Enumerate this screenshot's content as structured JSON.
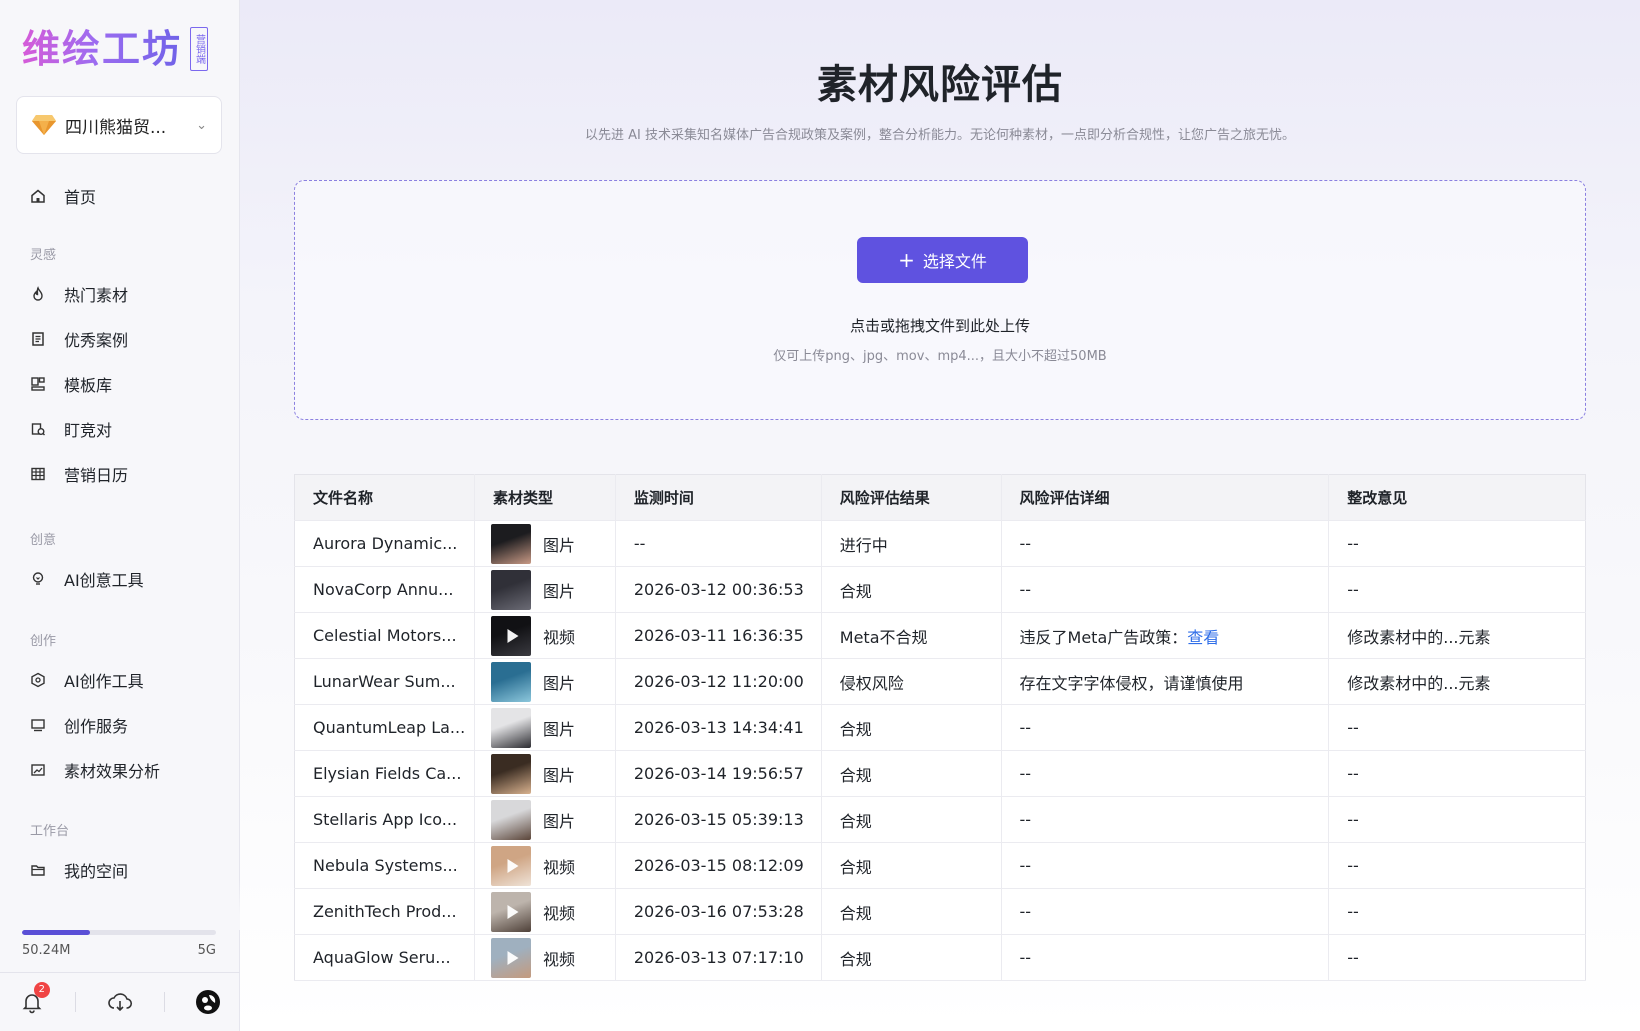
{
  "brand": {
    "logo_text": "维绘工坊",
    "logo_badge": "营销端"
  },
  "company": {
    "name": "四川熊猫贸..."
  },
  "nav": {
    "home": "首页",
    "group_inspire": "灵感",
    "hot": "热门素材",
    "cases": "优秀案例",
    "templates": "模板库",
    "competitor": "盯竞对",
    "calendar": "营销日历",
    "group_creative": "创意",
    "ai_idea": "AI创意工具",
    "group_create": "创作",
    "ai_create": "AI创作工具",
    "service": "创作服务",
    "analysis": "素材效果分析",
    "group_workspace": "工作台",
    "my_space": "我的空间"
  },
  "storage": {
    "used": "50.24M",
    "total": "5G",
    "fraction": 0.35
  },
  "notifications": {
    "count": "2"
  },
  "page": {
    "title": "素材风险评估",
    "subtitle": "以先进 AI 技术采集知名媒体广告合规政策及案例，整合分析能力。无论何种素材，一点即分析合规性，让您广告之旅无忧。"
  },
  "upload": {
    "button": "选择文件",
    "hint": "点击或拖拽文件到此处上传",
    "limit": "仅可上传png、jpg、mov、mp4...，且大小不超过50MB"
  },
  "table": {
    "headers": [
      "文件名称",
      "素材类型",
      "监测时间",
      "风险评估结果",
      "风险评估详细",
      "整改意见"
    ],
    "rows": [
      {
        "name": "Aurora Dynamic...",
        "type": "图片",
        "video": false,
        "time": "--",
        "result": "进行中",
        "status": "pending",
        "detail": "--",
        "detail_link": "",
        "advice": "--",
        "thumb": [
          "#1c1c1f",
          "#c99a86"
        ]
      },
      {
        "name": "NovaCorp Annu...",
        "type": "图片",
        "video": false,
        "time": "2026-03-12 00:36:53",
        "result": "合规",
        "status": "ok",
        "detail": "--",
        "detail_link": "",
        "advice": "--",
        "thumb": [
          "#303038",
          "#6b6b75"
        ]
      },
      {
        "name": "Celestial Motors...",
        "type": "视频",
        "video": true,
        "time": "2026-03-11 16:36:35",
        "result": "Meta不合规",
        "status": "bad",
        "detail": "违反了Meta广告政策：",
        "detail_link": "查看",
        "advice": "修改素材中的...元素",
        "thumb": [
          "#111114",
          "#3a3a40"
        ]
      },
      {
        "name": "LunarWear Sum...",
        "type": "图片",
        "video": false,
        "time": "2026-03-12 11:20:00",
        "result": "侵权风险",
        "status": "bad",
        "detail": "存在文字字体侵权，请谨慎使用",
        "detail_link": "",
        "advice": "修改素材中的...元素",
        "thumb": [
          "#2a6e92",
          "#8cc7dc"
        ]
      },
      {
        "name": "QuantumLeap La...",
        "type": "图片",
        "video": false,
        "time": "2026-03-13 14:34:41",
        "result": "合规",
        "status": "ok",
        "detail": "--",
        "detail_link": "",
        "advice": "--",
        "thumb": [
          "#e4e4e6",
          "#2b2b30"
        ]
      },
      {
        "name": "Elysian Fields Ca...",
        "type": "图片",
        "video": false,
        "time": "2026-03-14 19:56:57",
        "result": "合规",
        "status": "ok",
        "detail": "--",
        "detail_link": "",
        "advice": "--",
        "thumb": [
          "#3a2c22",
          "#d9b28f"
        ]
      },
      {
        "name": "Stellaris App Ico...",
        "type": "图片",
        "video": false,
        "time": "2026-03-15 05:39:13",
        "result": "合规",
        "status": "ok",
        "detail": "--",
        "detail_link": "",
        "advice": "--",
        "thumb": [
          "#d8d8da",
          "#5a4438"
        ]
      },
      {
        "name": "Nebula Systems...",
        "type": "视频",
        "video": true,
        "time": "2026-03-15 08:12:09",
        "result": "合规",
        "status": "ok",
        "detail": "--",
        "detail_link": "",
        "advice": "--",
        "thumb": [
          "#cfa584",
          "#efe3d8"
        ]
      },
      {
        "name": "ZenithTech Prod...",
        "type": "视频",
        "video": true,
        "time": "2026-03-16 07:53:28",
        "result": "合规",
        "status": "ok",
        "detail": "--",
        "detail_link": "",
        "advice": "--",
        "thumb": [
          "#bdb4ac",
          "#4e4038"
        ]
      },
      {
        "name": "AquaGlow Seru...",
        "type": "视频",
        "video": true,
        "time": "2026-03-13 07:17:10",
        "result": "合规",
        "status": "ok",
        "detail": "--",
        "detail_link": "",
        "advice": "--",
        "thumb": [
          "#9fb0bf",
          "#c49a7d"
        ]
      }
    ]
  },
  "colors": {
    "accent": "#5f52e0",
    "ok": "#1fa84f",
    "bad": "#ee3b3b",
    "pending": "#f2872b",
    "link": "#2f6ee8"
  }
}
